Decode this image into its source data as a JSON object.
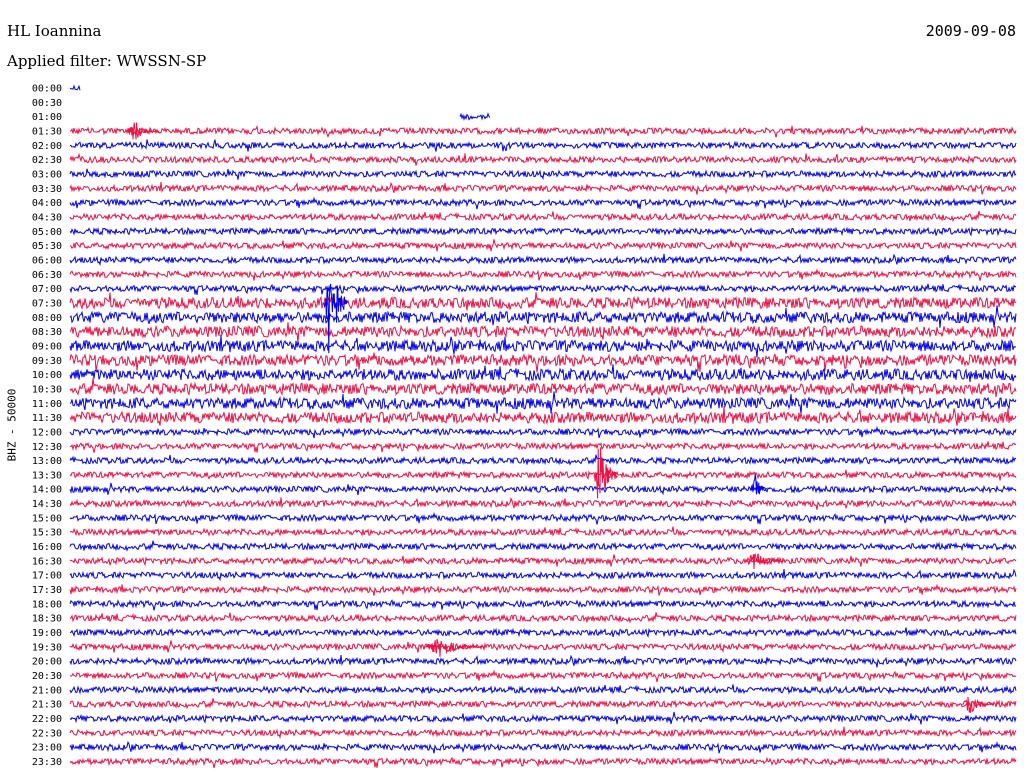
{
  "header": {
    "station": "HL Ioannina",
    "date": "2009-09-08",
    "filter": "Applied filter: WWSSN-SP"
  },
  "chart_data": {
    "type": "helicorder",
    "ylabel": "BHZ - 50000",
    "row_labels": [
      "00:00",
      "00:30",
      "01:00",
      "01:30",
      "02:00",
      "02:30",
      "03:00",
      "03:30",
      "04:00",
      "04:30",
      "05:00",
      "05:30",
      "06:00",
      "06:30",
      "07:00",
      "07:30",
      "08:00",
      "08:30",
      "09:00",
      "09:30",
      "10:00",
      "10:30",
      "11:00",
      "11:30",
      "12:00",
      "12:30",
      "13:00",
      "13:30",
      "14:00",
      "14:30",
      "15:00",
      "15:30",
      "16:00",
      "16:30",
      "17:00",
      "17:30",
      "18:00",
      "18:30",
      "19:00",
      "19:30",
      "20:00",
      "20:30",
      "21:00",
      "21:30",
      "22:00",
      "22:30",
      "23:00",
      "23:30"
    ],
    "colors": [
      "#0000ee",
      "#ee1144"
    ],
    "data_gap_rows": [
      0,
      1,
      2
    ]
  }
}
